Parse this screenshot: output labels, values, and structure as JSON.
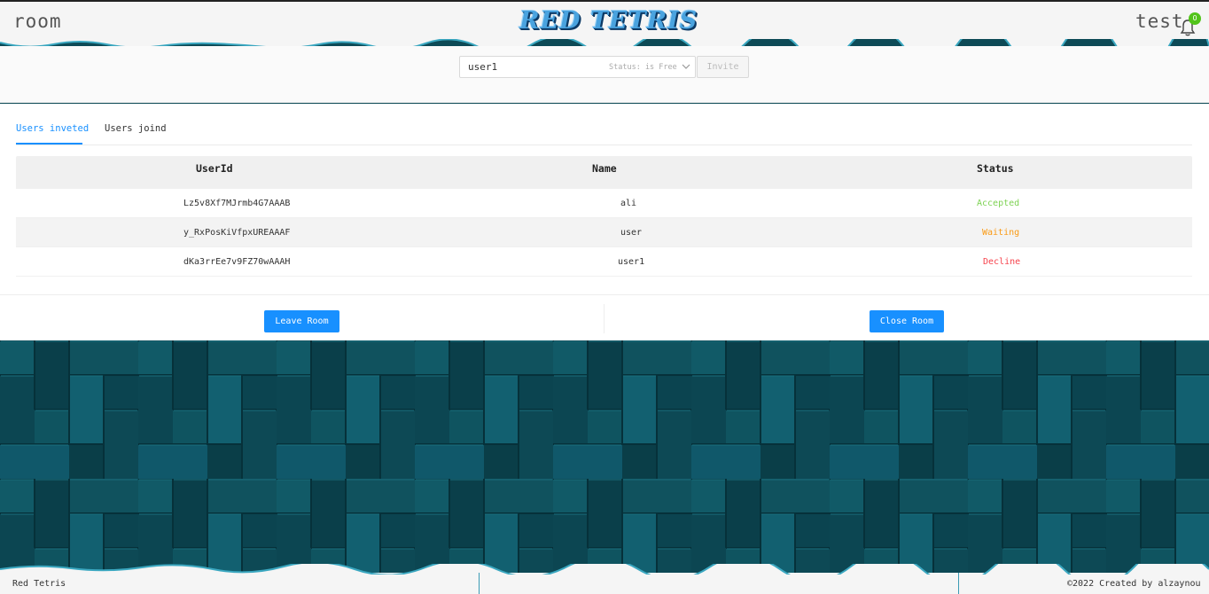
{
  "header": {
    "page_name": "room",
    "logo_text": "RED TETRIS",
    "user_name": "test",
    "notification_count": "0"
  },
  "invite": {
    "selected_user": "user1",
    "selected_status": "Status: is Free",
    "invite_label": "Invite"
  },
  "tabs": [
    {
      "label": "Users inveted",
      "active": true
    },
    {
      "label": "Users joind",
      "active": false
    }
  ],
  "table": {
    "columns": [
      "UserId",
      "Name",
      "Status"
    ],
    "rows": [
      {
        "user_id": "Lz5v8Xf7MJrmb4G7AAAB",
        "name": "ali",
        "status": "Accepted"
      },
      {
        "user_id": "y_RxPosKiVfpxUREAAAF",
        "name": "user",
        "status": "Waiting"
      },
      {
        "user_id": "dKa3rrEe7v9FZ70wAAAH",
        "name": "user1",
        "status": "Decline"
      }
    ]
  },
  "actions": {
    "leave_label": "Leave Room",
    "close_label": "Close Room"
  },
  "footer": {
    "left_text": "Red Tetris",
    "right_text": "©2022 Created by alzaynou"
  },
  "colors": {
    "primary": "#1890ff",
    "accepted": "#52c41a",
    "waiting": "#fa9a14",
    "decline": "#f5222d",
    "background": "#0d4a56"
  }
}
